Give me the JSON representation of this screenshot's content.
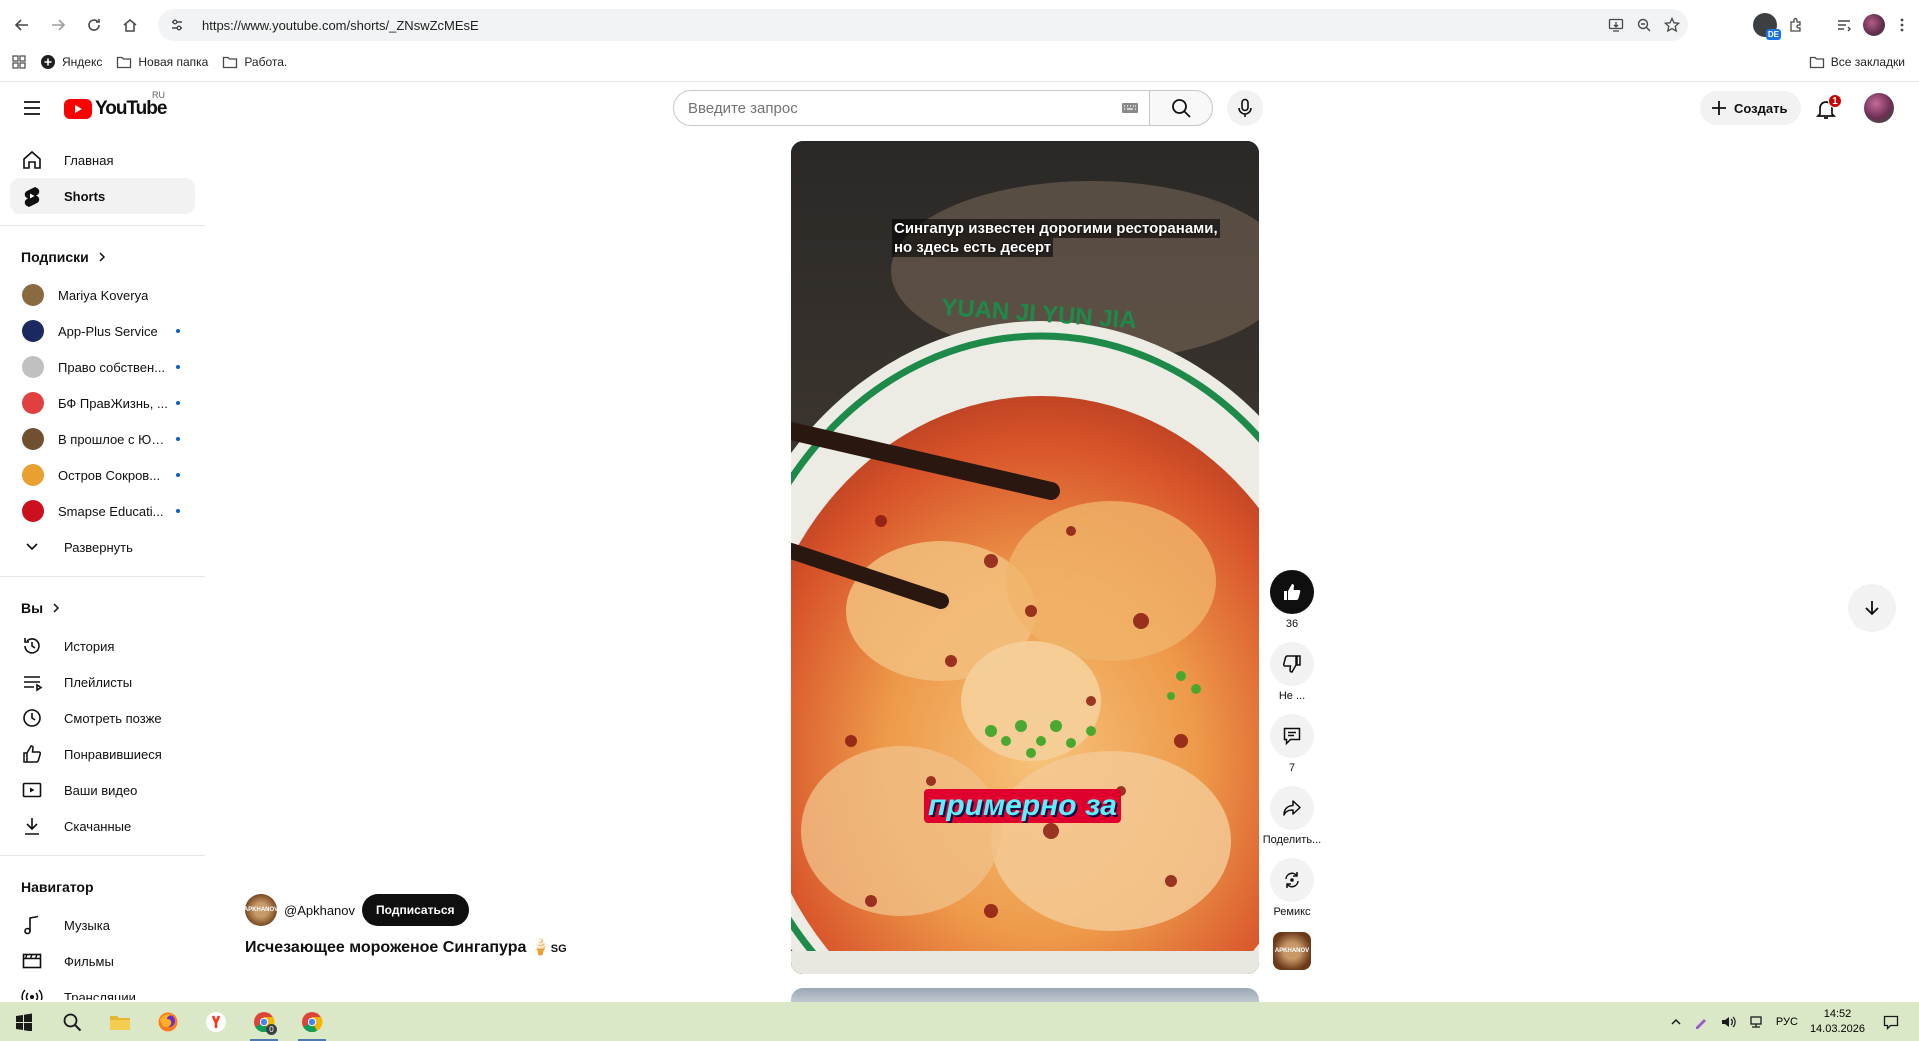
{
  "browser": {
    "url": "https://www.youtube.com/shorts/_ZNswZcMEsE",
    "bookmarks": [
      "Яндекс",
      "Новая папка",
      "Работа."
    ],
    "all_bookmarks": "Все закладки",
    "ext_badge": "DE"
  },
  "youtube": {
    "logo_text": "YouTube",
    "country_code": "RU",
    "search_placeholder": "Введите запрос",
    "create_label": "Создать",
    "notif_count": "1"
  },
  "sidebar": {
    "main": [
      {
        "label": "Главная",
        "icon": "home-icon"
      },
      {
        "label": "Shorts",
        "icon": "shorts-icon"
      }
    ],
    "subs_title": "Подписки",
    "subscriptions": [
      {
        "label": "Mariya Koverya",
        "color": "#8a6a40",
        "dot": false
      },
      {
        "label": "App-Plus Service",
        "color": "#1a2a60",
        "dot": true
      },
      {
        "label": "Право собствен...",
        "color": "#c0c0c0",
        "dot": true
      },
      {
        "label": "БФ ПравЖизнь, ...",
        "color": "#e04040",
        "dot": true
      },
      {
        "label": "В прошлое с Юр...",
        "color": "#705030",
        "dot": true
      },
      {
        "label": "Остров Сокров...",
        "color": "#e8a030",
        "dot": true
      },
      {
        "label": "Smapse Educati...",
        "color": "#cc1020",
        "dot": true
      }
    ],
    "expand_label": "Развернуть",
    "you_title": "Вы",
    "you_items": [
      {
        "label": "История",
        "icon": "history-icon"
      },
      {
        "label": "Плейлисты",
        "icon": "playlists-icon"
      },
      {
        "label": "Смотреть позже",
        "icon": "watch-later-icon"
      },
      {
        "label": "Понравившиеся",
        "icon": "liked-icon"
      },
      {
        "label": "Ваши видео",
        "icon": "your-videos-icon"
      },
      {
        "label": "Скачанные",
        "icon": "downloads-icon"
      }
    ],
    "nav_title": "Навигатор",
    "nav_items": [
      {
        "label": "Музыка",
        "icon": "music-icon"
      },
      {
        "label": "Фильмы",
        "icon": "movies-icon"
      },
      {
        "label": "Трансляции",
        "icon": "live-icon"
      }
    ]
  },
  "short": {
    "caption_top": "Сингапур известен дорогими ресторанами, но здесь есть десерт",
    "caption_mid": "примерно за",
    "plate_text": "YUAN JI YUN JIA",
    "channel_handle": "@Apkhanov",
    "channel_avatar_text": "APKHANOV",
    "subscribe_label": "Подписаться",
    "title": "Исчезающее мороженое Сингапура 🍦",
    "title_suffix": "SG"
  },
  "actions": {
    "like_count": "36",
    "dislike_label": "Не ...",
    "comments_count": "7",
    "share_label": "Поделить...",
    "remix_label": "Ремикс"
  },
  "taskbar": {
    "chrome_badge": "0",
    "lang": "РУС",
    "time": "14:52",
    "date": "14.03.2026"
  }
}
